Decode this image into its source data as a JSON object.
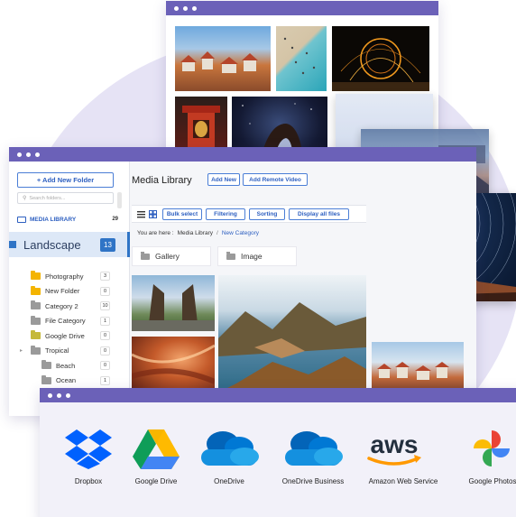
{
  "colors": {
    "window_bar": "#6b61b8",
    "accent_blue": "#2f74c6",
    "blob": "#e6e3f5"
  },
  "sidebar": {
    "add_folder_label": "+ Add New Folder",
    "search_placeholder": "Search folders...",
    "media_library_label": "MEDIA LIBRARY",
    "media_library_count": "29",
    "selected_folder": {
      "label": "Landscape",
      "count": "13"
    },
    "folders": [
      {
        "label": "Photography",
        "count": "3",
        "color": "#f4b400",
        "indent": 0,
        "caret": false
      },
      {
        "label": "New Folder",
        "count": "0",
        "color": "#f4b400",
        "indent": 0,
        "caret": false
      },
      {
        "label": "Category 2",
        "count": "10",
        "color": "#9a9a9a",
        "indent": 0,
        "caret": false
      },
      {
        "label": "File Category",
        "count": "1",
        "color": "#9a9a9a",
        "indent": 0,
        "caret": false
      },
      {
        "label": "Google Drive",
        "count": "0",
        "color": "#c5b93a",
        "indent": 0,
        "caret": false
      },
      {
        "label": "Tropical",
        "count": "0",
        "color": "#9a9a9a",
        "indent": 0,
        "caret": true
      },
      {
        "label": "Beach",
        "count": "0",
        "color": "#9a9a9a",
        "indent": 1,
        "caret": false
      },
      {
        "label": "Ocean",
        "count": "1",
        "color": "#9a9a9a",
        "indent": 1,
        "caret": false
      }
    ]
  },
  "main": {
    "title": "Media Library",
    "add_new_label": "Add New",
    "add_remote_label": "Add Remote Video",
    "toolbar": {
      "bulk_select": "Bulk select",
      "filtering": "Filtering",
      "sorting": "Sorting",
      "display_all": "Display all files"
    },
    "breadcrumb": {
      "prefix": "You are here :",
      "parent": "Media Library",
      "separator": "/",
      "current": "New Category"
    },
    "folder_tiles": [
      "Gallery",
      "Image"
    ]
  },
  "cloud_services": [
    "Dropbox",
    "Google Drive",
    "OneDrive",
    "OneDrive Business",
    "Amazon Web Service",
    "Google Photos"
  ],
  "aws_logo_text": "aws"
}
